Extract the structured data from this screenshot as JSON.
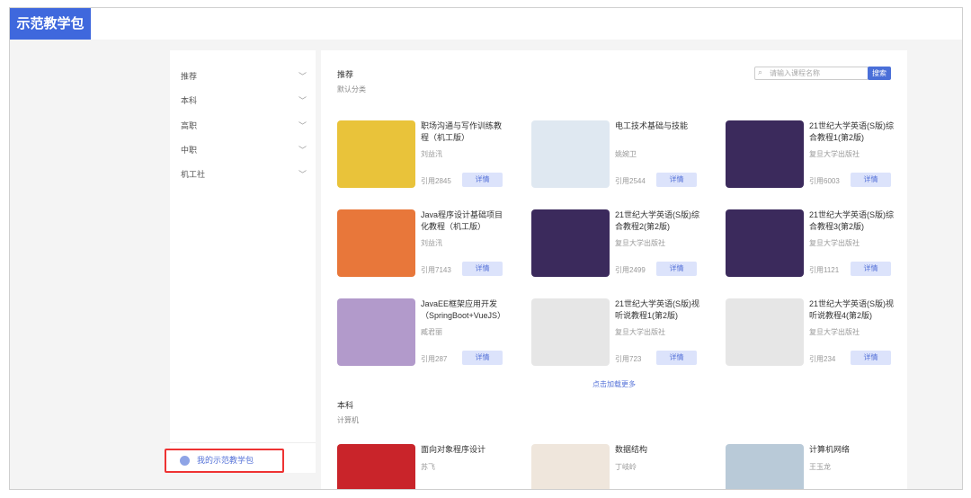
{
  "header": {
    "logo": "示范教学包"
  },
  "sidebar": {
    "items": [
      {
        "label": "推荐"
      },
      {
        "label": "本科"
      },
      {
        "label": "高职"
      },
      {
        "label": "中职"
      },
      {
        "label": "机工社"
      }
    ],
    "my_pack": "我的示范教学包"
  },
  "main": {
    "section1": {
      "title": "推荐",
      "subtitle": "默认分类"
    },
    "search": {
      "placeholder": "请输入课程名称",
      "button": "搜索"
    },
    "detail_label": "详情",
    "cards": [
      {
        "title": "职场沟通与写作训练教程（机工版）",
        "author": "刘益汛",
        "cite": "引用2845",
        "color": "#e9c33a"
      },
      {
        "title": "电工技术基础与技能",
        "author": "姚婉卫",
        "cite": "引用2544",
        "color": "#dfe8f1"
      },
      {
        "title": "21世纪大学英语(S版)综合教程1(第2版)",
        "author": "复旦大学出版社",
        "cite": "引用6003",
        "color": "#3b2a5c"
      },
      {
        "title": "Java程序设计基础项目化教程（机工版）",
        "author": "刘益汛",
        "cite": "引用7143",
        "color": "#e8773a"
      },
      {
        "title": "21世纪大学英语(S版)综合教程2(第2版)",
        "author": "复旦大学出版社",
        "cite": "引用2499",
        "color": "#3b2a5c"
      },
      {
        "title": "21世纪大学英语(S版)综合教程3(第2版)",
        "author": "复旦大学出版社",
        "cite": "引用1121",
        "color": "#3b2a5c"
      },
      {
        "title": "JavaEE框架应用开发（SpringBoot+VueJS）",
        "author": "臧君丽",
        "cite": "引用287",
        "color": "#b29acb"
      },
      {
        "title": "21世纪大学英语(S版)视听说教程1(第2版)",
        "author": "复旦大学出版社",
        "cite": "引用723",
        "color": "#e6e6e6"
      },
      {
        "title": "21世纪大学英语(S版)视听说教程4(第2版)",
        "author": "复旦大学出版社",
        "cite": "引用234",
        "color": "#e6e6e6"
      }
    ],
    "load_more": "点击加载更多",
    "section2": {
      "title": "本科",
      "subtitle": "计算机"
    },
    "cards2": [
      {
        "title": "面向对象程序设计",
        "author": "苏飞",
        "color": "#c9242a"
      },
      {
        "title": "数据结构",
        "author": "丁岐岭",
        "color": "#efe6dc"
      },
      {
        "title": "计算机网络",
        "author": "王玉龙",
        "color": "#b9cad8"
      }
    ]
  }
}
